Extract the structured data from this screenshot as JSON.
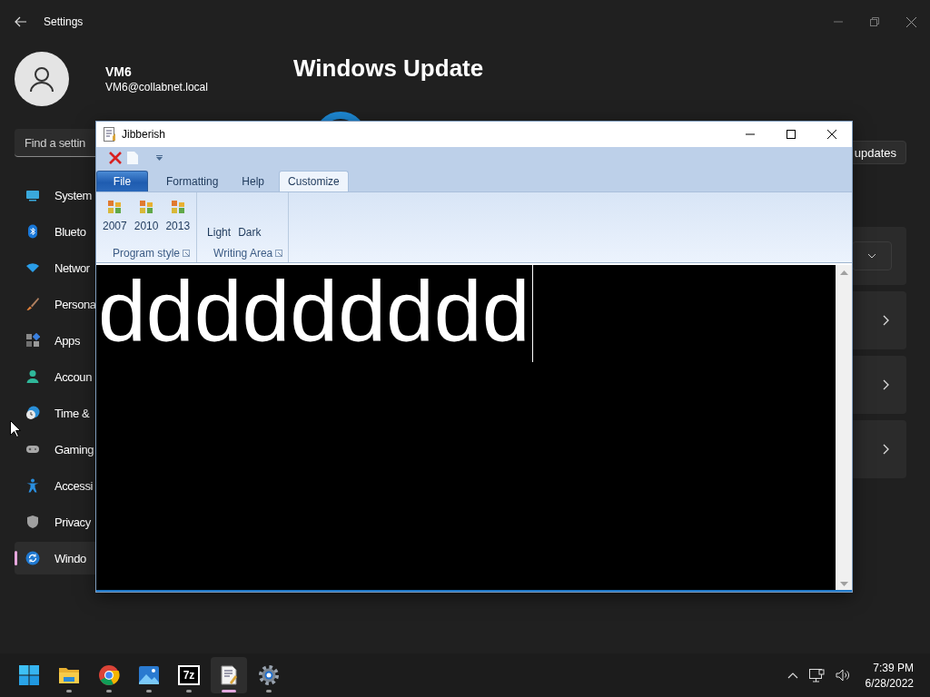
{
  "settings": {
    "title": "Settings",
    "user": {
      "name": "VM6",
      "email": "VM6@collabnet.local"
    },
    "search": {
      "placeholder": "Find a settin"
    },
    "nav": [
      {
        "label": "System",
        "selected": false
      },
      {
        "label": "Blueto",
        "selected": false
      },
      {
        "label": "Networ",
        "selected": false
      },
      {
        "label": "Persona",
        "selected": false
      },
      {
        "label": "Apps",
        "selected": false
      },
      {
        "label": "Accoun",
        "selected": false
      },
      {
        "label": "Time &",
        "selected": false
      },
      {
        "label": "Gaming",
        "selected": false
      },
      {
        "label": "Accessi",
        "selected": false
      },
      {
        "label": "Privacy",
        "selected": false
      },
      {
        "label": "Windo",
        "selected": true
      }
    ],
    "page_title": "Windows Update",
    "action_button": "updates",
    "cards": [
      {
        "kind": "dropdown"
      },
      {
        "kind": "link"
      },
      {
        "kind": "link"
      },
      {
        "kind": "link"
      }
    ]
  },
  "jibberish": {
    "title": "Jibberish",
    "tabs": [
      {
        "label": "File",
        "kind": "file",
        "selected": false
      },
      {
        "label": "Formatting",
        "kind": "tab",
        "selected": false
      },
      {
        "label": "Help",
        "kind": "tab",
        "selected": false
      },
      {
        "label": "Customize",
        "kind": "tab",
        "selected": true
      }
    ],
    "groups": [
      {
        "label": "Program style",
        "kind": "icons",
        "buttons": [
          "2007",
          "2010",
          "2013"
        ]
      },
      {
        "label": "Writing Area",
        "kind": "plain",
        "buttons": [
          "Light",
          "Dark"
        ]
      }
    ],
    "editor": {
      "text": "ddddddddd"
    }
  },
  "taskbar": {
    "apps": [
      {
        "kind": "start",
        "running": false,
        "selected": false
      },
      {
        "kind": "folder",
        "running": true,
        "selected": false
      },
      {
        "kind": "browser",
        "running": true,
        "selected": false
      },
      {
        "kind": "photos",
        "running": true,
        "selected": false
      },
      {
        "kind": "archiver",
        "label": "7z",
        "running": true,
        "selected": false
      },
      {
        "kind": "editor",
        "running": true,
        "selected": true
      },
      {
        "kind": "settings",
        "running": true,
        "selected": false
      }
    ],
    "time": "7:39 PM",
    "date": "6/28/2022"
  }
}
